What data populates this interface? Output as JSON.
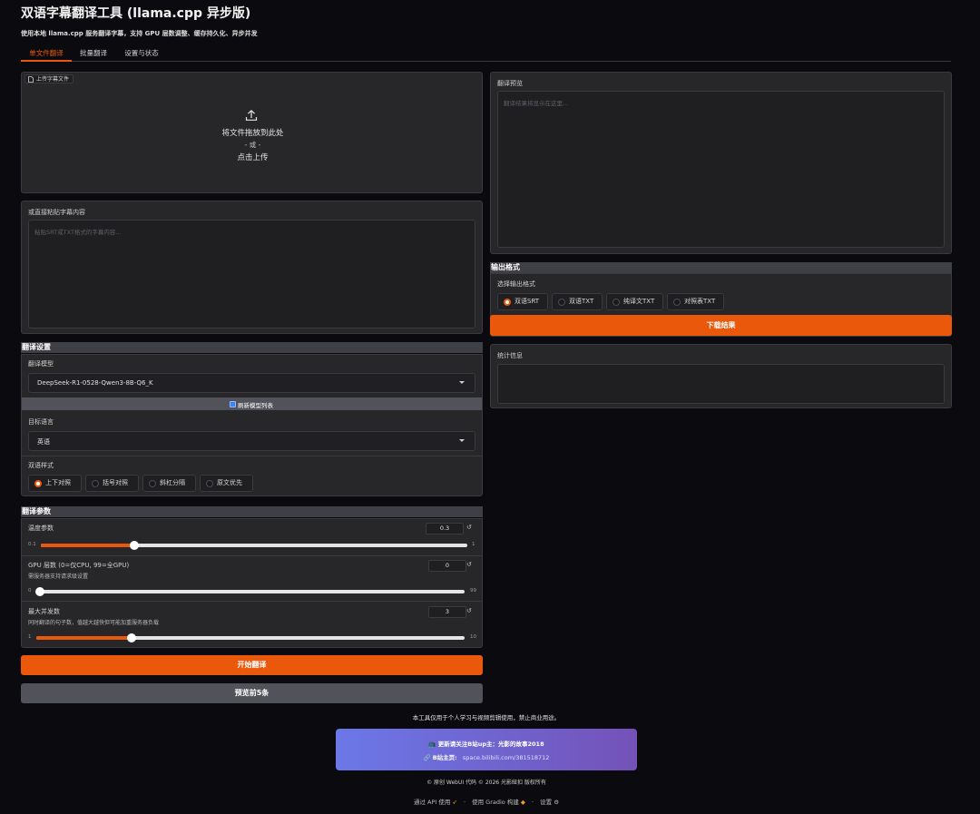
{
  "app": {
    "title": "双语字幕翻译工具 (llama.cpp 异步版)",
    "subtitle": "使用本地 llama.cpp 服务翻译字幕，支持 GPU 层数调整、缓存持久化、异步并发"
  },
  "tabs": [
    {
      "label": "单文件翻译",
      "active": true
    },
    {
      "label": "批量翻译",
      "active": false
    },
    {
      "label": "设置与状态",
      "active": false
    }
  ],
  "upload": {
    "badge": "上传字幕文件",
    "icon": "upload-icon",
    "line1": "将文件拖放到此处",
    "line2": "- 或 -",
    "line3": "点击上传"
  },
  "paste": {
    "label": "或直接粘贴字幕内容",
    "placeholder": "粘贴SRT或TXT格式的字幕内容..."
  },
  "translate_settings": {
    "header": "翻译设置",
    "model_label": "翻译模型",
    "model_value": "DeepSeek-R1-0528-Qwen3-8B-Q6_K",
    "refresh_label": "刷新模型列表",
    "refresh_checked": true,
    "target_label": "目标语言",
    "target_value": "英语",
    "style_label": "双语样式",
    "styles": [
      {
        "label": "上下对照",
        "selected": true
      },
      {
        "label": "括号对照",
        "selected": false
      },
      {
        "label": "斜杠分隔",
        "selected": false
      },
      {
        "label": "原文优先",
        "selected": false
      }
    ]
  },
  "params": {
    "header": "翻译参数",
    "temperature": {
      "label": "温度参数",
      "value": "0.3",
      "min": "0.1",
      "max": "1",
      "fraction": 0.22
    },
    "gpu_layers": {
      "label": "GPU 层数 (0=仅CPU, 99=全GPU)",
      "hint": "需服务器支持请求级设置",
      "value": "0",
      "min": "0",
      "max": "99",
      "fraction": 0.0
    },
    "concurrency": {
      "label": "最大并发数",
      "hint": "同时翻译的句子数，值越大越快但可能加重服务器负载",
      "value": "3",
      "min": "1",
      "max": "10",
      "fraction": 0.222
    }
  },
  "actions": {
    "start": "开始翻译",
    "preview": "预览前5条"
  },
  "preview": {
    "label": "翻译预览",
    "placeholder": "翻译结果将显示在这里..."
  },
  "output": {
    "header": "输出格式",
    "label": "选择输出格式",
    "formats": [
      {
        "label": "双语SRT",
        "selected": true
      },
      {
        "label": "双语TXT",
        "selected": false
      },
      {
        "label": "纯译文TXT",
        "selected": false
      },
      {
        "label": "对照表TXT",
        "selected": false
      }
    ],
    "download": "下载结果"
  },
  "stats": {
    "label": "统计信息"
  },
  "footer": {
    "notice": "本工具仅用于个人学习与视频剪辑使用，禁止商业用途。",
    "banner_line1": "更新请关注B站up主：光影的故事2018",
    "banner_line2_label": "B站主页:",
    "banner_link": "space.bilibili.com/381518712",
    "copyright": "© 原创 WebUI 代码 © 2026 光影紐扣 版权所有",
    "api": "通过 API 使用",
    "built": "使用 Gradio 构建",
    "settings": "设置",
    "sep": "·"
  },
  "colors": {
    "accent": "#ea580c",
    "background": "#0b0b0f",
    "panel": "#27272a",
    "banner_from": "#6b78e8",
    "banner_to": "#7452b8"
  }
}
